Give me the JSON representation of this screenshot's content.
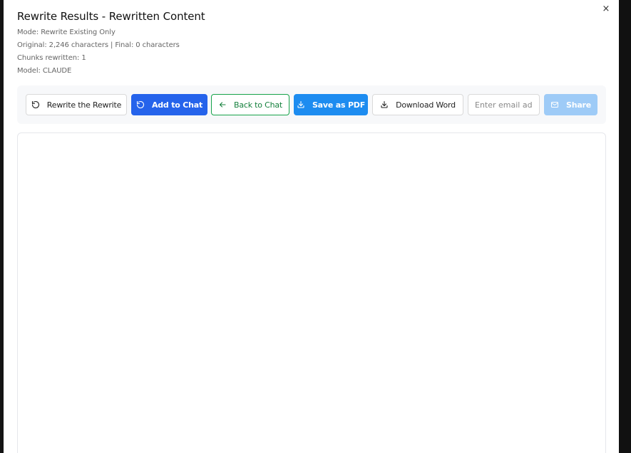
{
  "modal": {
    "title": "Rewrite Results - Rewritten Content",
    "close_label": "×",
    "mode": "Mode: Rewrite Existing Only",
    "original": "Original: 2,246 characters | Final: 0 characters",
    "chunks": "Chunks rewritten: 1",
    "model": "Model: CLAUDE"
  },
  "toolbar": {
    "rewrite_label": "Rewrite the Rewrite",
    "add_chat_label": "Add to Chat",
    "back_label": "Back to Chat",
    "pdf_label": "Save as PDF",
    "word_label": "Download Word",
    "email_placeholder": "Enter email address",
    "email_value": "",
    "share_label": "Share"
  },
  "icons": {
    "rewrite": "refresh-icon",
    "add_chat": "refresh-icon",
    "back": "arrow-left-icon",
    "pdf": "download-icon",
    "word": "download-icon",
    "share": "mail-icon",
    "close": "close-icon"
  },
  "colors": {
    "primary": "#2563eb",
    "pdf_blue": "#1d8cf0",
    "back_green": "#16a34a",
    "share_disabled": "#9ecbf7"
  },
  "content": {
    "text": ""
  }
}
